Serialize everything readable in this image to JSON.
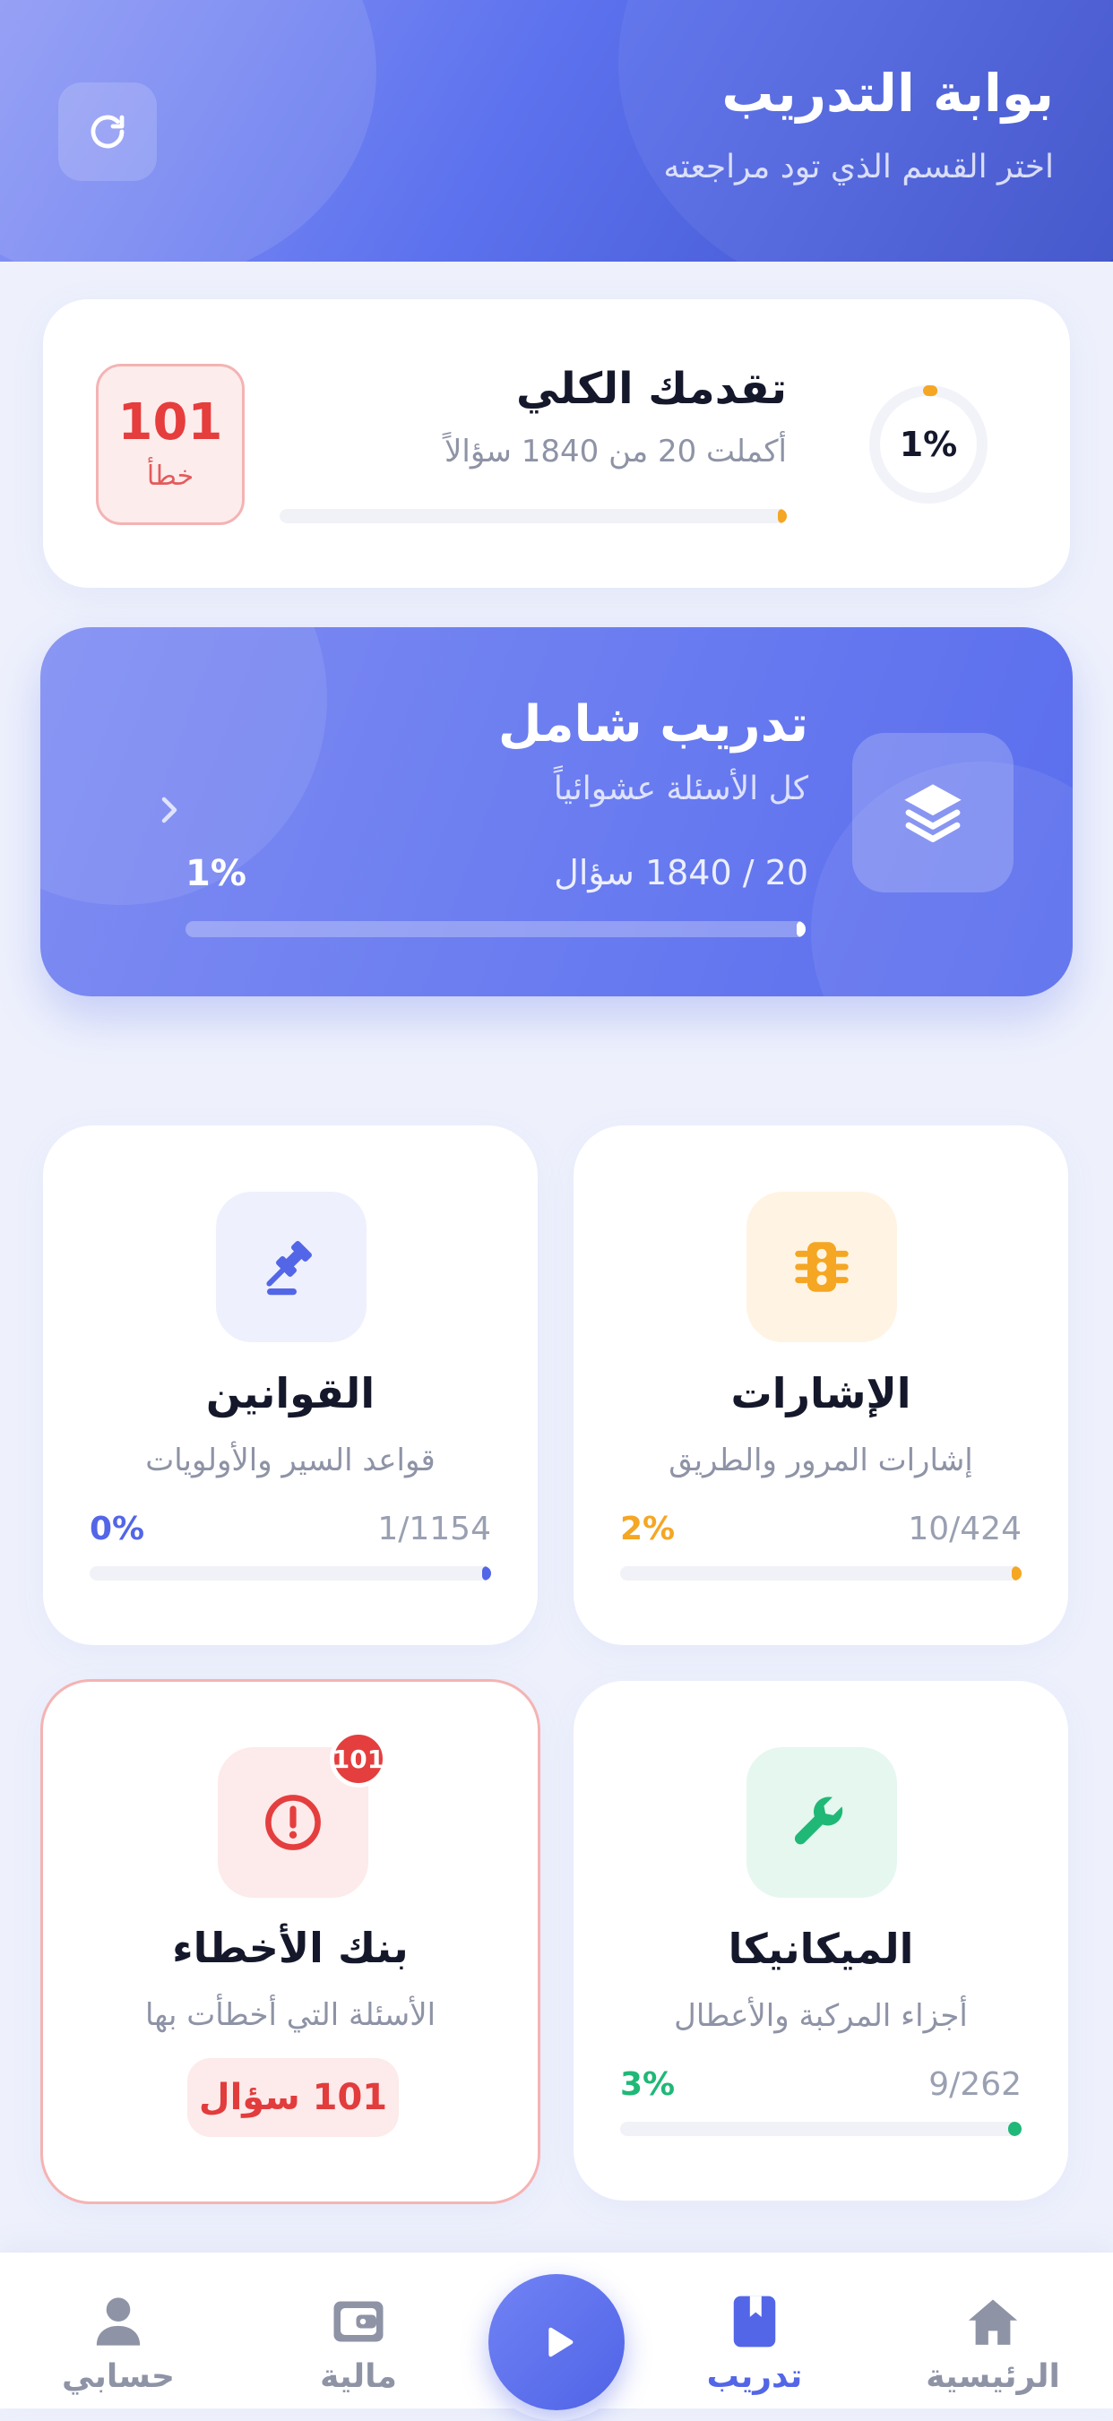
{
  "header": {
    "title": "بوابة التدريب",
    "subtitle": "اختر القسم الذي تود مراجعته",
    "refresh_icon": "refresh-icon"
  },
  "overall_progress": {
    "title": "تقدمك الكلي",
    "subtitle": "أكملت 20 من 1840 سؤالاً",
    "percent_label": "1%",
    "completed": 20,
    "total": 1840,
    "progress_fraction": 0.011,
    "errors_count": "101",
    "errors_label": "خطأ",
    "accent_color": "#f5a623"
  },
  "comprehensive": {
    "title": "تدريب شامل",
    "subtitle": "كل الأسئلة عشوائياً",
    "count_text": "20 / 1840 سؤال",
    "percent_label": "1%",
    "progress_fraction": 0.011,
    "icon": "layers-icon"
  },
  "categories": [
    {
      "key": "signs",
      "title": "الإشارات",
      "subtitle": "إشارات المرور والطريق",
      "count_text": "10/424",
      "percent_label": "2%",
      "progress_fraction": 0.024,
      "color": "#f5a623",
      "bg_color": "#fff4e3",
      "icon": "traffic-light-icon"
    },
    {
      "key": "laws",
      "title": "القوانين",
      "subtitle": "قواعد السير والأولويات",
      "count_text": "1/1154",
      "percent_label": "0%",
      "progress_fraction": 0.001,
      "color": "#5366e8",
      "bg_color": "#eef0fd",
      "icon": "gavel-icon"
    },
    {
      "key": "mechanics",
      "title": "الميكانيكا",
      "subtitle": "أجزاء المركبة والأعطال",
      "count_text": "9/262",
      "percent_label": "3%",
      "progress_fraction": 0.034,
      "color": "#1fb877",
      "bg_color": "#e6f7ef",
      "icon": "wrench-icon"
    }
  ],
  "error_bank": {
    "title": "بنك الأخطاء",
    "subtitle": "الأسئلة التي أخطأت بها",
    "badge": "101",
    "pill_text": "101 سؤال",
    "color": "#e53e3e",
    "bg_color": "#fdeaea",
    "icon": "alert-circle-icon"
  },
  "nav": {
    "items": [
      {
        "label": "الرئيسية",
        "icon": "home-icon",
        "active": false
      },
      {
        "label": "تدريب",
        "icon": "bookmark-book-icon",
        "active": true
      },
      {
        "label": "مالية",
        "icon": "wallet-icon",
        "active": false
      },
      {
        "label": "حسابي",
        "icon": "user-icon",
        "active": false
      }
    ],
    "center_icon": "play-icon",
    "active_color": "#5366e8",
    "inactive_color": "#8e93a6"
  }
}
